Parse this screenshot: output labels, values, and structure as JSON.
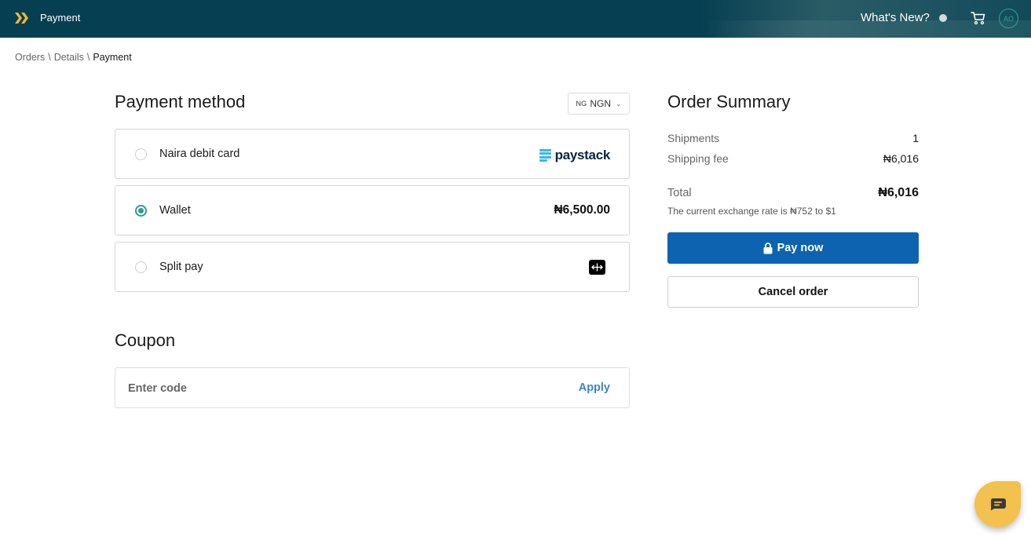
{
  "header": {
    "app_title": "Payment",
    "whats_new": "What's New?",
    "avatar_initials": "AO",
    "icons": {
      "logo": "double-chevron-logo",
      "cart": "cart-icon",
      "status": "status-dot"
    }
  },
  "breadcrumb": {
    "items": [
      "Orders",
      "Details",
      "Payment"
    ],
    "separator": "\\"
  },
  "payment": {
    "title": "Payment method",
    "currency": {
      "flag": "NG",
      "code": "NGN"
    },
    "options": [
      {
        "label": "Naira debit card",
        "provider": "paystack",
        "selected": false
      },
      {
        "label": "Wallet",
        "balance": "₦6,500.00",
        "selected": true
      },
      {
        "label": "Split pay",
        "icon": "split-arrows-icon",
        "selected": false
      }
    ]
  },
  "coupon": {
    "title": "Coupon",
    "placeholder": "Enter code",
    "value": "",
    "apply_label": "Apply"
  },
  "summary": {
    "title": "Order Summary",
    "rows": [
      {
        "label": "Shipments",
        "value": "1"
      },
      {
        "label": "Shipping fee",
        "value": "₦6,016"
      }
    ],
    "total_label": "Total",
    "total_value": "₦6,016",
    "exchange_rate": "The current exchange rate is ₦752 to $1",
    "pay_label": "Pay now",
    "cancel_label": "Cancel order"
  },
  "colors": {
    "header_bg": "#073f52",
    "accent_teal": "#2a9d8f",
    "primary_blue": "#0d63b0",
    "link_blue": "#3b86c6",
    "chat_yellow": "#f3c14d",
    "paystack_blue": "#3bb6e8"
  }
}
